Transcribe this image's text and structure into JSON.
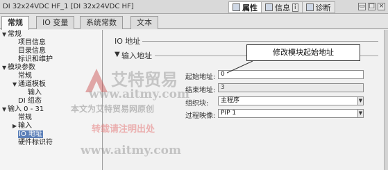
{
  "window": {
    "title": "DI 32x24VDC HF_1 [DI 32x24VDC HF]",
    "inspector_tabs": [
      {
        "label": "属性",
        "icon": "properties-icon",
        "active": true
      },
      {
        "label": "信息",
        "icon": "info-icon",
        "suffix": "i",
        "active": false
      },
      {
        "label": "诊断",
        "icon": "diagnostics-icon",
        "active": false
      }
    ]
  },
  "tabs": [
    {
      "label": "常规",
      "active": true
    },
    {
      "label": "IO 变量",
      "active": false
    },
    {
      "label": "系统常数",
      "active": false
    },
    {
      "label": "文本",
      "active": false
    }
  ],
  "tree": [
    {
      "label": "常规",
      "arrow": "▼",
      "level": 0
    },
    {
      "label": "项目信息",
      "level": 1
    },
    {
      "label": "目录信息",
      "level": 1
    },
    {
      "label": "标识和维护",
      "level": 1
    },
    {
      "label": "模块参数",
      "arrow": "▼",
      "level": 0
    },
    {
      "label": "常规",
      "level": 1
    },
    {
      "label": "通道模板",
      "arrow": "▼",
      "level": 1
    },
    {
      "label": "输入",
      "level": 2
    },
    {
      "label": "DI 组态",
      "level": 1
    },
    {
      "label": "输入 0 - 31",
      "arrow": "▼",
      "level": 0
    },
    {
      "label": "常规",
      "level": 1
    },
    {
      "label": "输入",
      "arrow": "▶",
      "level": 1
    },
    {
      "label": "IO 地址",
      "level": 1,
      "selected": true
    },
    {
      "label": "硬件标识符",
      "level": 1
    }
  ],
  "content": {
    "section_title": "IO 地址",
    "subsection_title": "输入地址",
    "fields": {
      "start_address": {
        "label": "起始地址:",
        "value": "0"
      },
      "end_address": {
        "label": "结束地址:",
        "value": "3"
      },
      "organization_block": {
        "label": "组织块:",
        "value": "主程序"
      },
      "process_image": {
        "label": "过程映像:",
        "value": "PIP 1"
      }
    },
    "callout": "修改模块起始地址"
  },
  "watermark": {
    "logo_letter": "A",
    "name": "艾特贸易",
    "url": "www.aitmy.com",
    "note": "本文为艾特贸易网原创",
    "note2": "转载请注明出处"
  }
}
